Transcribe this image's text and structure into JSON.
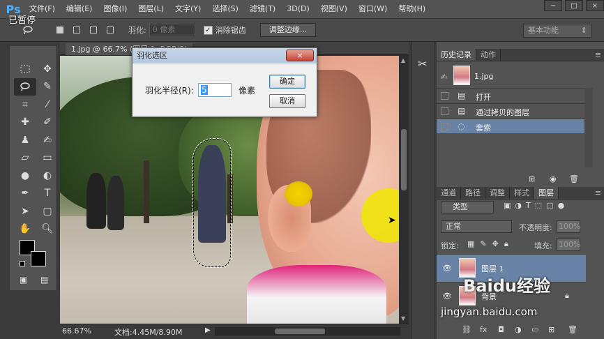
{
  "app": {
    "logo": "Ps"
  },
  "menu": [
    "文件(F)",
    "编辑(E)",
    "图像(I)",
    "图层(L)",
    "文字(Y)",
    "选择(S)",
    "滤镜(T)",
    "3D(D)",
    "视图(V)",
    "窗口(W)",
    "帮助(H)"
  ],
  "window_buttons": [
    "−",
    "□",
    "×"
  ],
  "overlay": {
    "paused": "已暂停"
  },
  "options": {
    "feather_label": "羽化:",
    "feather_value": "0 像素",
    "antialias_checked": true,
    "antialias_label": "消除锯齿",
    "refine_edge_button": "调整边缘...",
    "workspace": "基本功能"
  },
  "document": {
    "tab_title": "1.jpg @ 66.7% (图层 1, RGB/8)",
    "zoom": "66.67%",
    "info": "文档:4.45M/8.90M"
  },
  "dialog": {
    "title": "羽化选区",
    "radius_label": "羽化半径(R):",
    "radius_value": "5",
    "unit": "像素",
    "ok": "确定",
    "cancel": "取消",
    "close": "×"
  },
  "history_panel": {
    "tabs": [
      "历史记录",
      "动作"
    ],
    "snapshot": "1.jpg",
    "items": [
      {
        "label": "打开"
      },
      {
        "label": "通过拷贝的图层"
      },
      {
        "label": "套索",
        "selected": true
      }
    ]
  },
  "layers_panel": {
    "tabs": [
      "通道",
      "路径",
      "调整",
      "样式",
      "图层"
    ],
    "filter": "类型",
    "blend_mode": "正常",
    "opacity_label": "不透明度:",
    "opacity_value": "100%",
    "lock_label": "锁定:",
    "fill_label": "填充:",
    "fill_value": "100%",
    "layers": [
      {
        "name": "图层 1",
        "selected": true
      },
      {
        "name": "背景",
        "locked": true
      }
    ]
  },
  "watermark": {
    "brand": "Baidu经验",
    "url": "jingyan.baidu.com"
  },
  "colors": {
    "accent": "#4fb0ff",
    "selection": "#6883a6",
    "dialog_title": "#c7d7ea"
  }
}
